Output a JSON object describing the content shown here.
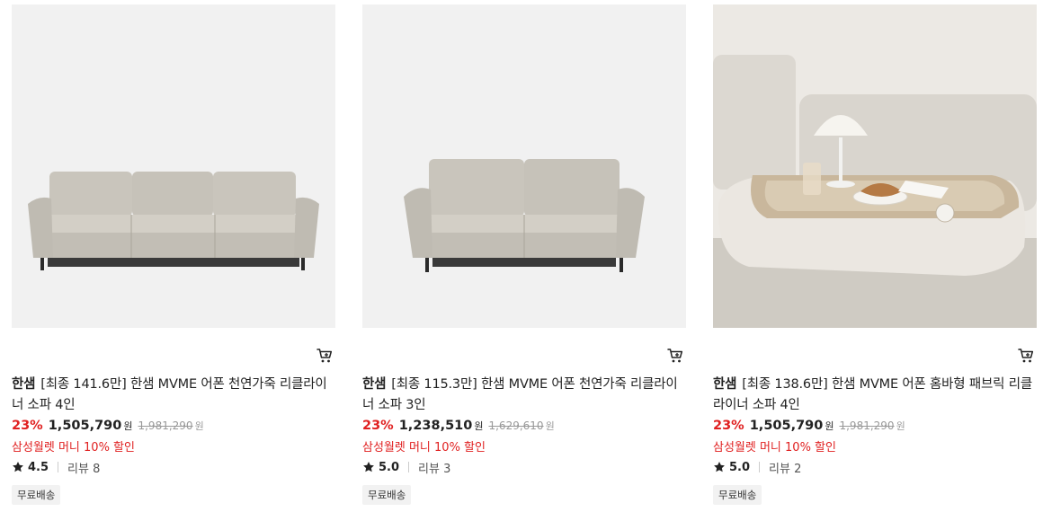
{
  "products": [
    {
      "image": "sofa-4-seater-photo",
      "brand": "한샘",
      "name": "[최종 141.6만] 한샘 MVME 어폰 천연가죽 리클라이너 소파 4인",
      "discount": "23%",
      "price": "1,505,790",
      "currency": "원",
      "original_price": "1,981,290",
      "promo": "삼성월렛 머니 10% 할인",
      "rating": "4.5",
      "review": "리뷰 8",
      "badge": "무료배송"
    },
    {
      "image": "sofa-3-seater-photo",
      "brand": "한샘",
      "name": "[최종 115.3만] 한샘 MVME 어폰 천연가죽 리클라이너 소파 3인",
      "discount": "23%",
      "price": "1,238,510",
      "currency": "원",
      "original_price": "1,629,610",
      "promo": "삼성월렛 머니 10% 할인",
      "rating": "5.0",
      "review": "리뷰 3",
      "badge": "무료배송"
    },
    {
      "image": "fabric-sofa-tray-photo",
      "brand": "한샘",
      "name": "[최종 138.6만] 한샘 MVME 어폰 홈바형 패브릭 리클라이너 소파 4인",
      "discount": "23%",
      "price": "1,505,790",
      "currency": "원",
      "original_price": "1,981,290",
      "promo": "삼성월렛 머니 10% 할인",
      "rating": "5.0",
      "review": "리뷰 2",
      "badge": "무료배송"
    }
  ],
  "icons": {
    "cart": "cart-icon",
    "star": "star-icon"
  },
  "colors": {
    "discount": "#e02020",
    "promo": "#e02020",
    "badge_bg": "#f2f2f2",
    "thumb_bg": "#f1f1f1"
  }
}
